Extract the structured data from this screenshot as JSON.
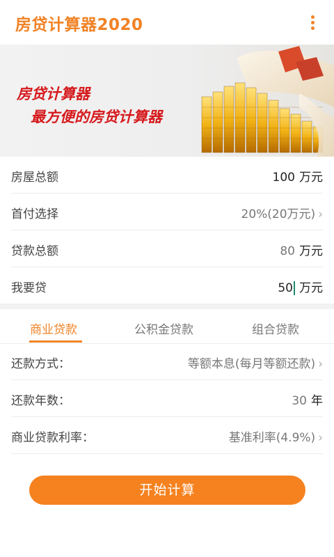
{
  "app": {
    "title": "房贷计算器2020"
  },
  "banner": {
    "line1": "房贷计算器",
    "line2": "最方便的房贷计算器"
  },
  "form": {
    "house_total": {
      "label": "房屋总额",
      "value": "100",
      "unit": "万元"
    },
    "down_payment": {
      "label": "首付选择",
      "value": "20%(20万元)"
    },
    "loan_total": {
      "label": "贷款总额",
      "value": "80",
      "unit": "万元"
    },
    "want_loan": {
      "label": "我要贷",
      "value": "50",
      "unit": "万元"
    }
  },
  "tabs": [
    {
      "label": "商业贷款",
      "active": true
    },
    {
      "label": "公积金贷款",
      "active": false
    },
    {
      "label": "组合贷款",
      "active": false
    }
  ],
  "options": {
    "repay_method": {
      "label": "还款方式：",
      "value": "等额本息(每月等额还款)"
    },
    "repay_years": {
      "label": "还款年数：",
      "value": "30",
      "unit": "年"
    },
    "rate": {
      "label": "商业贷款利率：",
      "value": "基准利率(4.9%)"
    }
  },
  "action": {
    "start_label": "开始计算"
  },
  "colors": {
    "accent": "#f08326",
    "banner_text": "#d6191c"
  }
}
